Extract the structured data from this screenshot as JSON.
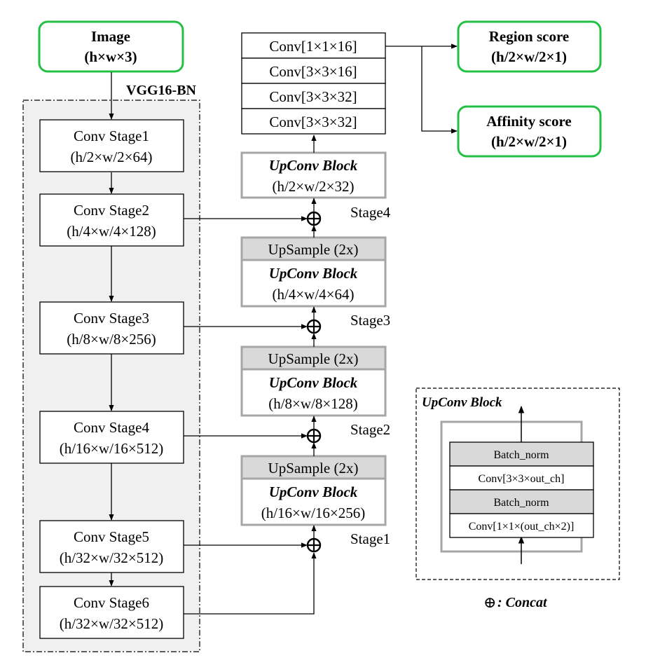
{
  "colors": {
    "output_border": "#22c043",
    "upsample_fill": "#d9d9d9",
    "block_border": "#a6a6a6",
    "backbone_fill": "#f0f0f0"
  },
  "input": {
    "title": "Image",
    "shape": "(h×w×3)"
  },
  "backbone": {
    "label": "VGG16-BN",
    "stages": [
      {
        "name": "Conv Stage1",
        "shape": "(h/2×w/2×64)"
      },
      {
        "name": "Conv Stage2",
        "shape": "(h/4×w/4×128)"
      },
      {
        "name": "Conv Stage3",
        "shape": "(h/8×w/8×256)"
      },
      {
        "name": "Conv Stage4",
        "shape": "(h/16×w/16×512)"
      },
      {
        "name": "Conv Stage5",
        "shape": "(h/32×w/32×512)"
      },
      {
        "name": "Conv Stage6",
        "shape": "(h/32×w/32×512)"
      }
    ]
  },
  "head": {
    "convs": [
      "Conv[1×1×16]",
      "Conv[3×3×16]",
      "Conv[3×3×32]",
      "Conv[3×3×32]"
    ]
  },
  "decoder": {
    "upsample_label": "UpSample (2x)",
    "block_label": "UpConv Block",
    "blocks": [
      {
        "stage": "Stage4",
        "shape": "(h/2×w/2×32)"
      },
      {
        "stage": "Stage3",
        "shape": "(h/4×w/4×64)"
      },
      {
        "stage": "Stage2",
        "shape": "(h/8×w/8×128)"
      },
      {
        "stage": "Stage1",
        "shape": "(h/16×w/16×256)"
      }
    ]
  },
  "outputs": [
    {
      "title": "Region score",
      "shape": "(h/2×w/2×1)"
    },
    {
      "title": "Affinity score",
      "shape": "(h/2×w/2×1)"
    }
  ],
  "legend": {
    "title": "UpConv Block",
    "layers": [
      "Batch_norm",
      "Conv[3×3×out_ch]",
      "Batch_norm",
      "Conv[1×1×(out_ch×2)]"
    ],
    "concat_symbol": "⊕",
    "concat_label": ": Concat"
  }
}
